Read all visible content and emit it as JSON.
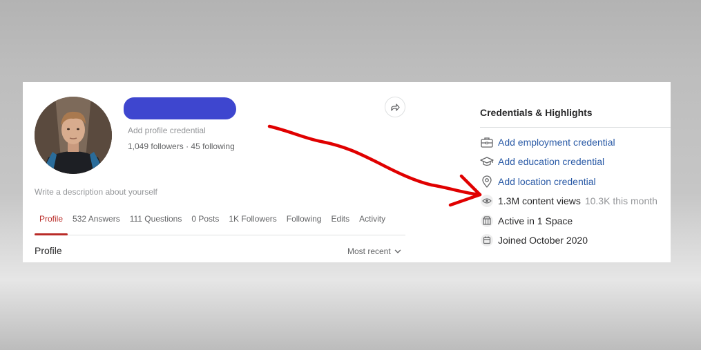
{
  "profile": {
    "credential_hint": "Add profile credential",
    "followers_text": "1,049 followers",
    "separator": "·",
    "following_text": "45 following",
    "description_hint": "Write a description about yourself"
  },
  "tabs": [
    {
      "label": "Profile"
    },
    {
      "label": "532 Answers"
    },
    {
      "label": "111 Questions"
    },
    {
      "label": "0 Posts"
    },
    {
      "label": "1K Followers"
    },
    {
      "label": "Following"
    },
    {
      "label": "Edits"
    },
    {
      "label": "Activity"
    }
  ],
  "main": {
    "section_title": "Profile",
    "sort_label": "Most recent"
  },
  "credentials": {
    "header": "Credentials & Highlights",
    "add_employment": "Add employment credential",
    "add_education": "Add education credential",
    "add_location": "Add location credential",
    "views_text": "1.3M content views",
    "views_month": "10.3K this month",
    "spaces_text": "Active in 1 Space",
    "joined_text": "Joined October 2020"
  },
  "colors": {
    "accent_red": "#b92b27",
    "link_blue": "#2a5aa6",
    "redaction_blue": "#3e46cf",
    "annotation_red": "#e00000"
  },
  "icons": [
    "share-icon",
    "briefcase-icon",
    "graduation-cap-icon",
    "location-pin-icon",
    "eye-icon",
    "spaces-icon",
    "calendar-icon",
    "chevron-down-icon"
  ]
}
